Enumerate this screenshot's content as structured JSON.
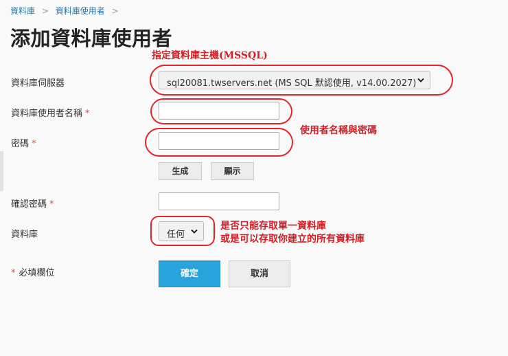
{
  "breadcrumb": {
    "item1": "資料庫",
    "item2": "資料庫使用者"
  },
  "title": "添加資料庫使用者",
  "form": {
    "server_label": "資料庫伺服器",
    "server_value": "sql20081.twservers.net (MS SQL 默認使用, v14.00.2027)",
    "username_label": "資料庫使用者名稱",
    "password_label": "密碼",
    "generate_label": "生成",
    "show_label": "顯示",
    "confirm_label": "確認密碼",
    "database_label": "資料庫",
    "database_value": "任何",
    "required_mark": "*",
    "required_note": "必填欄位",
    "ok_label": "確定",
    "cancel_label": "取消"
  },
  "annotations": {
    "server_note": "指定資料庫主機(MSSQL)",
    "credentials_note": "使用者名稱與密碼",
    "database_note_line1": "是否只能存取單一資料庫",
    "database_note_line2": "或是可以存取你建立的所有資料庫"
  },
  "colors": {
    "link": "#2573a6",
    "primary": "#28a3dc",
    "required": "#e64a3c",
    "annotation": "#e3242b"
  }
}
